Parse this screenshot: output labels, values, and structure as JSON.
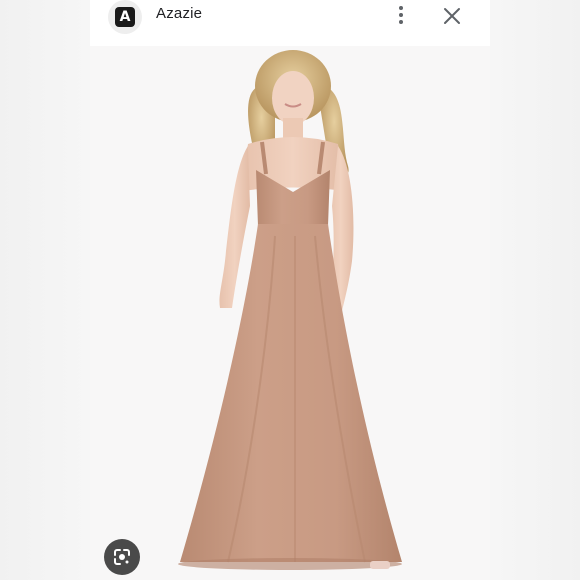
{
  "header": {
    "logo_letter": "A",
    "site_name": "Azazie"
  },
  "icons": {
    "logo": "azazie-logo-icon",
    "menu": "more-vert-icon",
    "close": "close-icon",
    "lens": "google-lens-icon"
  },
  "image": {
    "description_name": "product-photo"
  },
  "colors": {
    "dress": "#c99a82",
    "dress_shadow": "#b7876f",
    "background": "#f8f7f7",
    "lens_button": "#4a4a4a"
  }
}
